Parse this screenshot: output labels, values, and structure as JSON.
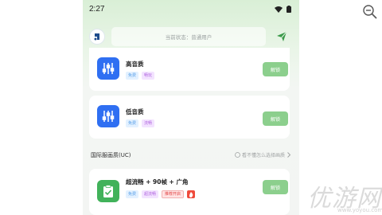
{
  "status_bar": {
    "time": "2:27"
  },
  "topbar": {
    "status_text": "当前状态：普通用户"
  },
  "modes": [
    {
      "title": "高音质",
      "tags": [
        "免费",
        "畅玩"
      ],
      "button": "解锁"
    },
    {
      "title": "低音质",
      "tags": [
        "免费",
        "流畅"
      ],
      "button": "解锁"
    },
    {
      "title": "超流畅 + 90帧 + 广角",
      "tags": [
        "免费",
        "超流畅",
        "推荐开启"
      ],
      "button": "解锁"
    }
  ],
  "section": {
    "title": "国际服画质(UC)",
    "hint": "看不懂怎么选择画质"
  },
  "watermark": {
    "brand": "优游网",
    "url": "www.yoyou.com"
  },
  "colors": {
    "accent_blue": "#2f6ff2",
    "accent_green": "#41b25a",
    "button_green": "#8ccf8d"
  }
}
